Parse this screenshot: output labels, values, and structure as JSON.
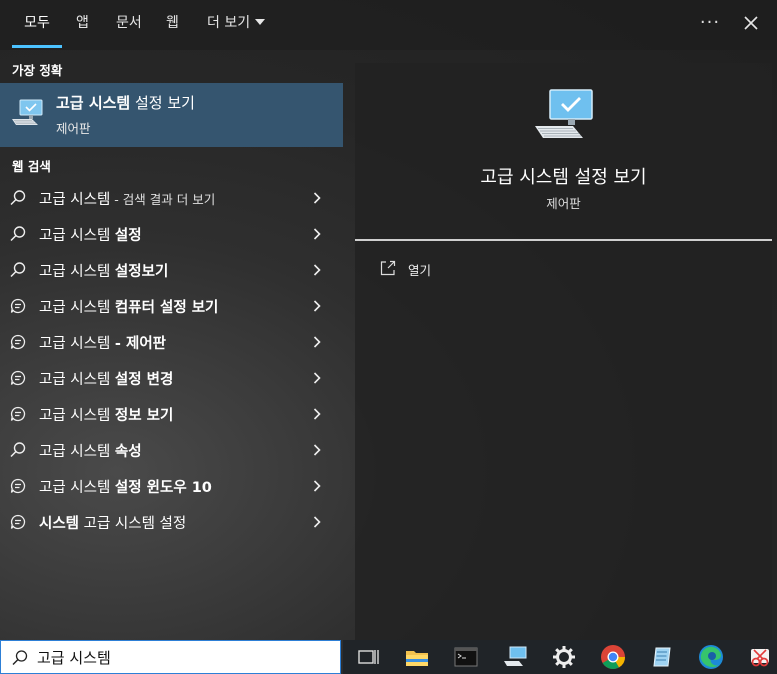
{
  "tabs": {
    "all": "모두",
    "apps": "앱",
    "documents": "문서",
    "web": "웹",
    "more": "더 보기",
    "options_glyph": "···"
  },
  "best_match": {
    "header": "가장 정확",
    "title_bold": "고급 시스템",
    "title_rest": " 설정 보기",
    "subtitle": "제어판",
    "icon": "system-settings-monitor-icon"
  },
  "web_search": {
    "header": "웹 검색",
    "items": [
      {
        "prefix": "고급 시스템",
        "suffix": " - 검색 결과 더 보기",
        "style": "light",
        "icon": "search-icon"
      },
      {
        "prefix": "고급 시스템 ",
        "suffix": "설정",
        "style": "bold",
        "icon": "search-icon"
      },
      {
        "prefix": "고급 시스템 ",
        "suffix": "설정보기",
        "style": "bold",
        "icon": "search-icon"
      },
      {
        "prefix": "고급 시스템 ",
        "suffix": "컴퓨터 설정 보기",
        "style": "bold",
        "icon": "chat-icon"
      },
      {
        "prefix": "고급 시스템 ",
        "suffix": "- 제어판",
        "style": "bold",
        "icon": "chat-icon"
      },
      {
        "prefix": "고급 시스템 ",
        "suffix": "설정 변경",
        "style": "bold",
        "icon": "chat-icon"
      },
      {
        "prefix": "고급 시스템 ",
        "suffix": "정보 보기",
        "style": "bold",
        "icon": "chat-icon"
      },
      {
        "prefix": "고급 시스템 ",
        "suffix": "속성",
        "style": "bold",
        "icon": "search-icon"
      },
      {
        "prefix": "고급 시스템 ",
        "suffix": "설정 윈도우 10",
        "style": "bold",
        "icon": "chat-icon"
      },
      {
        "prefix": "시스템",
        "suffix": " 고급 시스템 설정",
        "style": "prefixbold",
        "icon": "chat-icon"
      }
    ]
  },
  "preview": {
    "title": "고급 시스템 설정 보기",
    "subtitle": "제어판",
    "action_open": "열기"
  },
  "search": {
    "value": "고급 시스템"
  },
  "taskbar": {
    "icons": [
      "task-view-icon",
      "file-explorer-icon",
      "terminal-icon",
      "system-monitor-icon",
      "settings-gear-icon",
      "chrome-icon",
      "notepad-icon",
      "edge-icon",
      "snipping-tool-icon"
    ]
  },
  "colors": {
    "accent": "#4cc2ff",
    "selected_bg": "#35556f",
    "search_border": "#2d7fd6"
  }
}
